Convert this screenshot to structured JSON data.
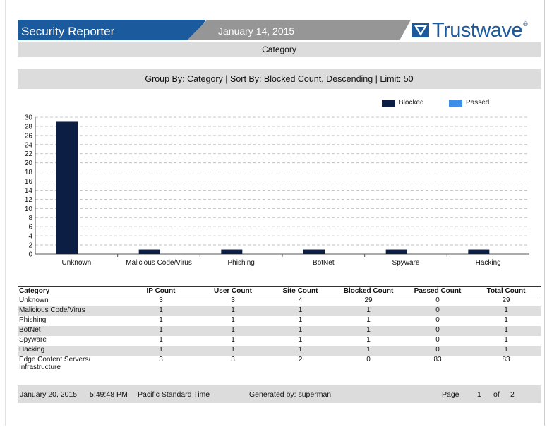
{
  "header": {
    "app_title": "Security Reporter",
    "report_date": "January 14, 2015",
    "logo_text": "Trustwave",
    "logo_mark": "®",
    "brand_color": "#1b5a9c"
  },
  "report": {
    "heading": "Category",
    "group_by": "Group By: Category | Sort By: Blocked Count, Descending | Limit: 50"
  },
  "chart_data": {
    "type": "bar",
    "categories": [
      "Unknown",
      "Malicious Code/Virus",
      "Phishing",
      "BotNet",
      "Spyware",
      "Hacking"
    ],
    "series": [
      {
        "name": "Blocked",
        "values": [
          29,
          1,
          1,
          1,
          1,
          1
        ],
        "color": "#0d1e45"
      },
      {
        "name": "Passed",
        "values": [
          0,
          0,
          0,
          0,
          0,
          0
        ],
        "color": "#3d8ee8"
      }
    ],
    "y_ticks": [
      0,
      2,
      4,
      6,
      8,
      10,
      12,
      14,
      16,
      18,
      20,
      22,
      24,
      26,
      28,
      30
    ],
    "ylim": [
      0,
      30
    ],
    "grid": true,
    "legend": "top-right"
  },
  "table": {
    "columns": [
      "Category",
      "IP Count",
      "User Count",
      "Site Count",
      "Blocked Count",
      "Passed Count",
      "Total Count"
    ],
    "rows": [
      [
        "Unknown",
        "3",
        "3",
        "4",
        "29",
        "0",
        "29"
      ],
      [
        "Malicious Code/Virus",
        "1",
        "1",
        "1",
        "1",
        "0",
        "1"
      ],
      [
        "Phishing",
        "1",
        "1",
        "1",
        "1",
        "0",
        "1"
      ],
      [
        "BotNet",
        "1",
        "1",
        "1",
        "1",
        "0",
        "1"
      ],
      [
        "Spyware",
        "1",
        "1",
        "1",
        "1",
        "0",
        "1"
      ],
      [
        "Hacking",
        "1",
        "1",
        "1",
        "1",
        "0",
        "1"
      ],
      [
        "Edge Content Servers/ Infrastructure",
        "3",
        "3",
        "2",
        "0",
        "83",
        "83"
      ]
    ]
  },
  "footer": {
    "date": "January 20, 2015",
    "time": "5:49:48 PM",
    "timezone": "Pacific Standard Time",
    "generated_by": "Generated by: superman",
    "page_label": "Page",
    "page_number": "1",
    "of_label": "of",
    "page_total": "2"
  }
}
